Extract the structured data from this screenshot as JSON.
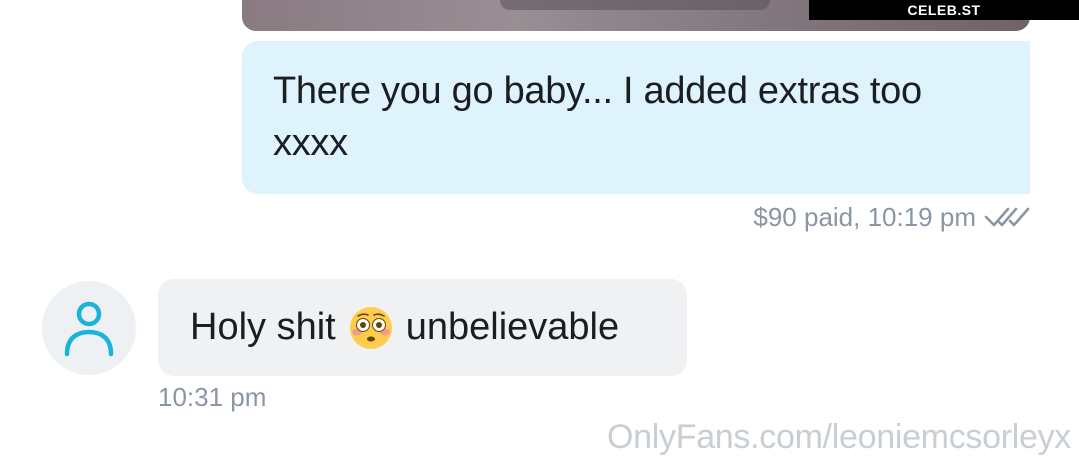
{
  "watermark_badge": "CELEB.ST",
  "outgoing_message": {
    "text_line1": "There you go baby... I added extras too",
    "text_line2": "xxxx",
    "meta": "$90 paid, 10:19 pm",
    "status_icon": "double-check-icon"
  },
  "incoming_message": {
    "avatar_icon": "user-icon",
    "text_before": "Holy shit",
    "emoji": "flushed-face-emoji",
    "text_after": "unbelievable",
    "time": "10:31 pm"
  },
  "site_watermark": "OnlyFans.com/leoniemcsorleyx",
  "colors": {
    "outgoing_bubble": "#def3fb",
    "incoming_bubble": "#f0f1f3",
    "meta_text": "#8a96a3",
    "avatar_accent": "#1bb3d8"
  }
}
